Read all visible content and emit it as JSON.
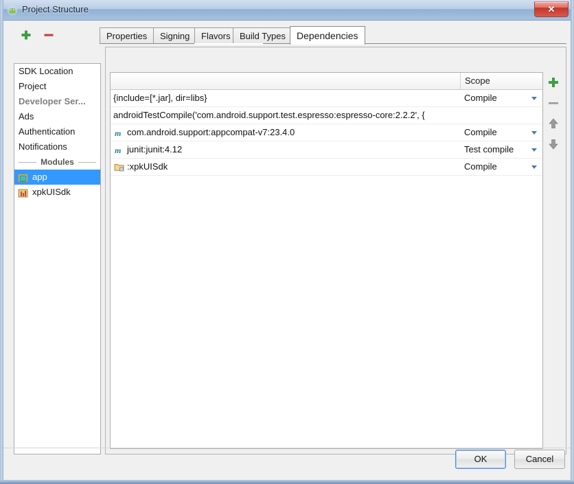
{
  "window": {
    "title": "Project Structure",
    "icon": "android-head-icon",
    "close_label": "✕"
  },
  "toolbar": {
    "add_label": "+",
    "remove_label": "−",
    "add_icon": "plus-icon",
    "remove_icon": "minus-icon"
  },
  "sidebar": {
    "items": [
      {
        "label": "SDK Location",
        "state": "normal",
        "icon": ""
      },
      {
        "label": "Project",
        "state": "normal",
        "icon": ""
      },
      {
        "label": "Developer Ser...",
        "state": "muted",
        "icon": ""
      },
      {
        "label": "Ads",
        "state": "normal",
        "icon": ""
      },
      {
        "label": "Authentication",
        "state": "normal",
        "icon": ""
      },
      {
        "label": "Notifications",
        "state": "normal",
        "icon": ""
      }
    ],
    "modules_separator": "Modules",
    "modules": [
      {
        "label": "app",
        "selected": true,
        "icon": "android-module-icon"
      },
      {
        "label": "xpkUISdk",
        "selected": false,
        "icon": "library-module-icon"
      }
    ]
  },
  "tabs": [
    {
      "label": "Properties",
      "active": false
    },
    {
      "label": "Signing",
      "active": false
    },
    {
      "label": "Flavors",
      "active": false
    },
    {
      "label": "Build Types",
      "active": false
    },
    {
      "label": "Dependencies",
      "active": true
    }
  ],
  "dependencies": {
    "columns": {
      "name": "",
      "scope": "Scope"
    },
    "rows": [
      {
        "name": "{include=[*.jar], dir=libs}",
        "scope": "Compile",
        "icon": "",
        "has_scope": true
      },
      {
        "name": "androidTestCompile('com.android.support.test.espresso:espresso-core:2.2.2', {",
        "scope": "",
        "icon": "",
        "has_scope": false
      },
      {
        "name": "com.android.support:appcompat-v7:23.4.0",
        "scope": "Compile",
        "icon": "maven-artifact-icon",
        "has_scope": true
      },
      {
        "name": "junit:junit:4.12",
        "scope": "Test compile",
        "icon": "maven-artifact-icon",
        "has_scope": true
      },
      {
        "name": ":xpkUISdk",
        "scope": "Compile",
        "icon": "module-folder-icon",
        "has_scope": true
      }
    ],
    "tools": [
      {
        "name": "add-dependency-button",
        "icon": "plus-icon",
        "label": "+"
      },
      {
        "name": "remove-dependency-button",
        "icon": "minus-icon",
        "label": "−"
      },
      {
        "name": "move-up-button",
        "icon": "arrow-up-icon",
        "label": "↑"
      },
      {
        "name": "move-down-button",
        "icon": "arrow-down-icon",
        "label": "↓"
      }
    ]
  },
  "footer": {
    "ok_label": "OK",
    "cancel_label": "Cancel"
  },
  "colors": {
    "selection_blue": "#3399ff",
    "accent_green": "#3e9e43",
    "accent_red": "#c14545",
    "dropdown_arrow": "#4a79ad",
    "titlebar_blue": "#8fb0d4"
  }
}
